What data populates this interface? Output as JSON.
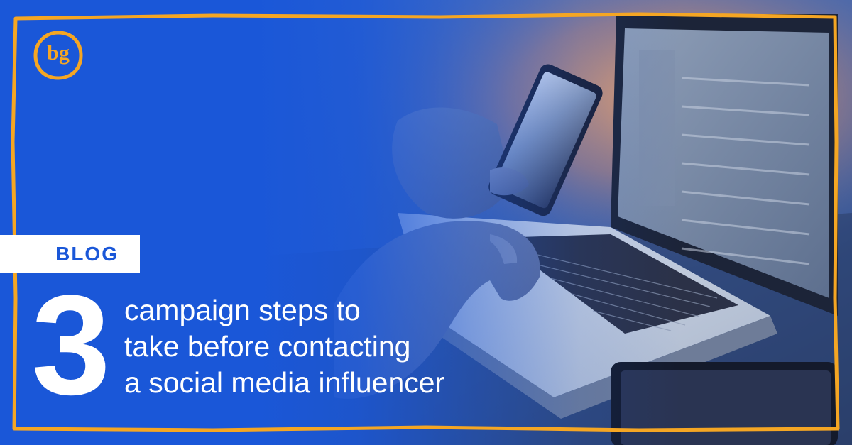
{
  "brand": {
    "logo_icon": "bg-monogram-logo",
    "logo_text": "bg",
    "colors": {
      "background": "#1a57d8",
      "accent": "#f5a623",
      "text": "#ffffff"
    }
  },
  "tag": {
    "label": "BLOG"
  },
  "headline": {
    "number": "3",
    "lines": [
      "campaign steps to",
      "take before contacting",
      "a social media influencer"
    ]
  },
  "photo": {
    "subject": "hands-holding-smartphone-and-typing-on-laptop"
  }
}
